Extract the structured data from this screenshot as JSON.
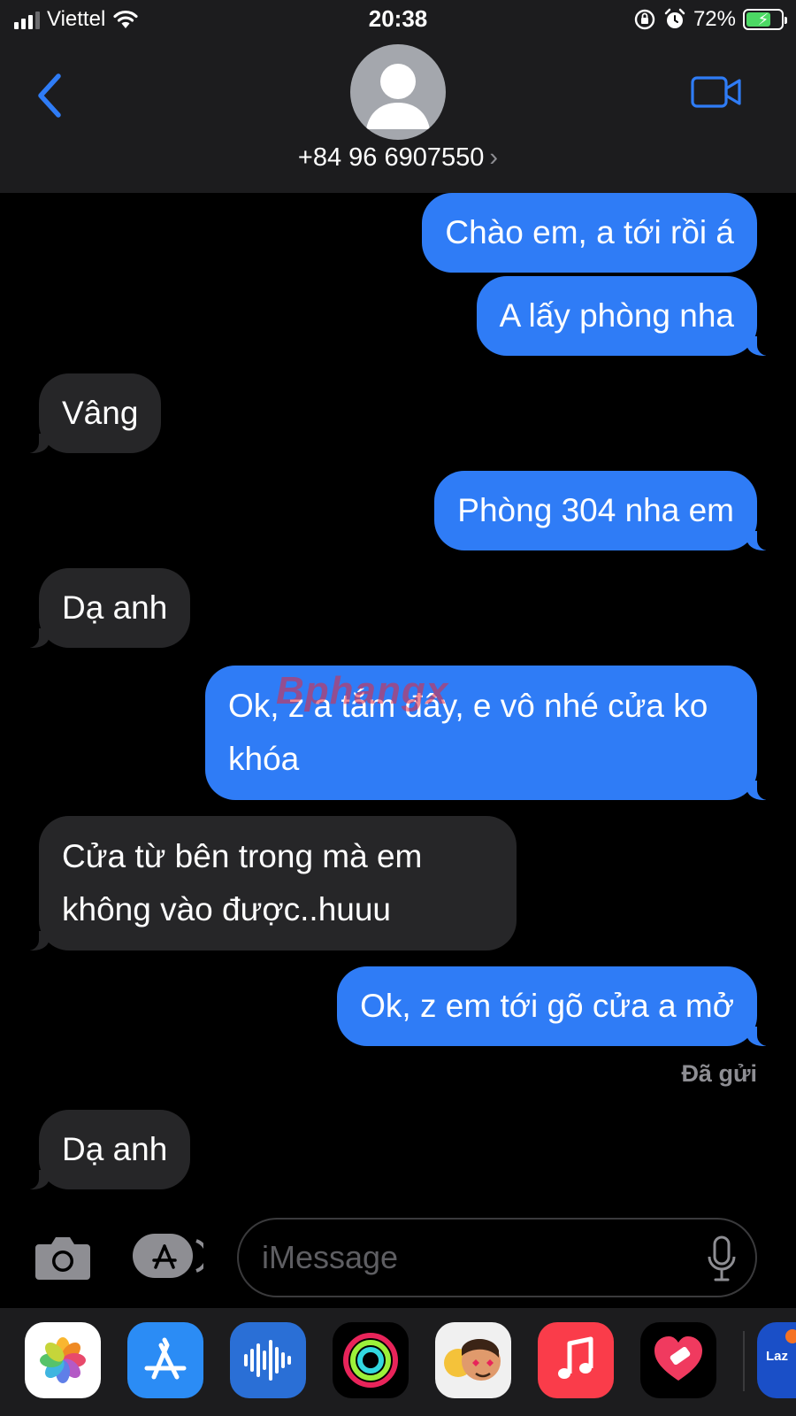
{
  "status_bar": {
    "carrier": "Viettel",
    "time": "20:38",
    "battery_percent": "72%",
    "battery_level": 0.72,
    "charging": true
  },
  "header": {
    "contact": "+84 96 6907550",
    "chevron": "›",
    "back_icon": "chevron-left-icon",
    "video_icon": "video-camera-icon"
  },
  "messages": [
    {
      "direction": "sent",
      "text": "Chào em, a tới rồi á"
    },
    {
      "direction": "sent",
      "text": "A lấy phòng nha"
    },
    {
      "direction": "received",
      "text": "Vâng"
    },
    {
      "direction": "sent",
      "text": "Phòng 304 nha em"
    },
    {
      "direction": "received",
      "text": "Dạ anh"
    },
    {
      "direction": "sent",
      "text": "Ok, z a tắm đây, e vô nhé cửa ko khóa"
    },
    {
      "direction": "received",
      "text": "Cửa từ bên trong mà em không vào được..huuu"
    },
    {
      "direction": "sent",
      "text": "Ok, z em tới gõ cửa a mở"
    },
    {
      "direction": "received",
      "text": "Dạ anh"
    }
  ],
  "delivery_status": "Đã gửi",
  "watermark": "Bphangx",
  "input": {
    "placeholder": "iMessage"
  },
  "app_drawer": {
    "apps": [
      "Photos",
      "App Store",
      "Audio Messages",
      "Activity",
      "Memoji",
      "Music",
      "#images",
      "Lazada"
    ],
    "lazada_label": "Laz"
  },
  "colors": {
    "sent_bubble": "#2f7cf6",
    "received_bubble": "#262628",
    "accent": "#2f7cf6",
    "background": "#000000"
  }
}
